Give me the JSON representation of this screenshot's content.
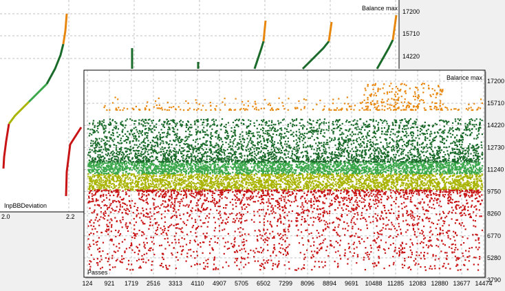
{
  "colors": {
    "orange": "#e8870e",
    "dark_green": "#1a6b2a",
    "mid_green": "#3aa84a",
    "yellow_green": "#a8b400",
    "red": "#c81414",
    "grid": "#c0c0c0"
  },
  "chart_data": [
    {
      "type": "scatter",
      "title": "",
      "panel": "background",
      "xlabel": "InpBBDeviation",
      "ylabel": "Balance max",
      "x_ticks": [
        "2.0",
        "2.2"
      ],
      "y_ticks": [
        "17200",
        "15710",
        "14220"
      ],
      "ylim": [
        12730,
        17500
      ],
      "description_note": "",
      "series": [
        {
          "values": []
        }
      ]
    },
    {
      "type": "scatter",
      "title": "",
      "panel": "foreground",
      "xlabel": "Passes",
      "ylabel": "Balance max",
      "x_ticks": [
        "124",
        "921",
        "1719",
        "2516",
        "3313",
        "4110",
        "4907",
        "5705",
        "6502",
        "7299",
        "8096",
        "8894",
        "9691",
        "10488",
        "11285",
        "12083",
        "12880",
        "13677",
        "14474"
      ],
      "y_ticks": [
        "17200",
        "15710",
        "14220",
        "12730",
        "11240",
        "9750",
        "8260",
        "6770",
        "5280",
        "3790"
      ],
      "xlim": [
        124,
        14474
      ],
      "ylim": [
        3790,
        17700
      ],
      "bands": [
        {
          "color_key": "orange",
          "range": [
            15300,
            17100
          ]
        },
        {
          "color_key": "dark_green",
          "range": [
            11800,
            14700
          ]
        },
        {
          "color_key": "mid_green",
          "range": [
            11000,
            11800
          ]
        },
        {
          "color_key": "yellow_green",
          "range": [
            9900,
            11000
          ]
        },
        {
          "color_key": "red",
          "range": [
            4500,
            9900
          ]
        }
      ]
    }
  ]
}
